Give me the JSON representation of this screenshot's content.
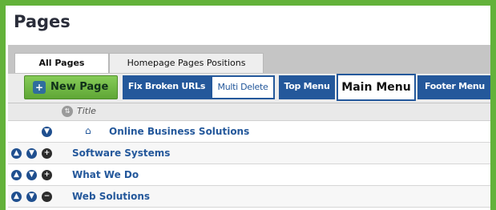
{
  "page": {
    "title": "Pages"
  },
  "tabs": [
    {
      "label": "All Pages"
    },
    {
      "label": "Homepage Pages Positions"
    }
  ],
  "toolbar": {
    "new_page": "New Page",
    "fix_broken_urls": "Fix Broken URLs",
    "multi_delete": "Multi Delete",
    "top_menu": "Top Menu",
    "main_menu": "Main Menu",
    "footer_menu": "Footer Menu"
  },
  "table": {
    "column_title": "Title",
    "rows": [
      {
        "name": "Online Business Solutions",
        "is_home": true
      },
      {
        "name": "Software Systems",
        "is_home": false
      },
      {
        "name": "What We Do",
        "is_home": false
      },
      {
        "name": "Web Solutions",
        "is_home": false
      }
    ]
  },
  "colors": {
    "frame_green": "#63b23a",
    "button_blue": "#24589b",
    "new_page_green": "#6bb340"
  }
}
